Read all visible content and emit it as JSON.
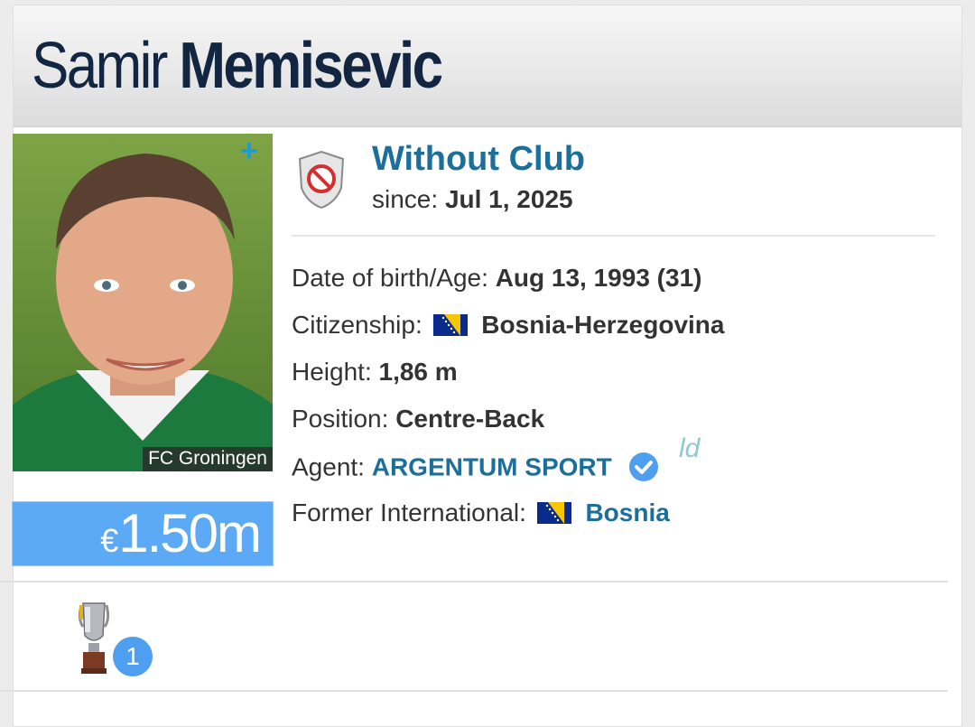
{
  "player": {
    "first_name": "Samir",
    "last_name": "Memisevic",
    "photo_club_caption": "FC Groningen",
    "market_value_currency": "€",
    "market_value": "1.50m"
  },
  "club": {
    "name": "Without Club",
    "since_label": "since:",
    "since_value": "Jul 1, 2025",
    "icon": "no-club-shield-icon"
  },
  "details": {
    "dob_label": "Date of birth/Age:",
    "dob_value": "Aug 13, 1993 (31)",
    "citizenship_label": "Citizenship:",
    "citizenship_value": "Bosnia-Herzegovina",
    "height_label": "Height:",
    "height_value": "1,86 m",
    "position_label": "Position:",
    "position_value": "Centre-Back",
    "agent_label": "Agent:",
    "agent_value": "ARGENTUM SPORT",
    "agent_badge_text": "ld",
    "former_international_label": "Former International:",
    "former_international_value": "Bosnia"
  },
  "achievements": {
    "trophy_icon": "trophy-icon",
    "count": "1"
  },
  "colors": {
    "accent_link": "#1d6f9b",
    "value_box": "#5ca9f6",
    "name_dark": "#122541",
    "badge_blue": "#4f9ff0"
  }
}
